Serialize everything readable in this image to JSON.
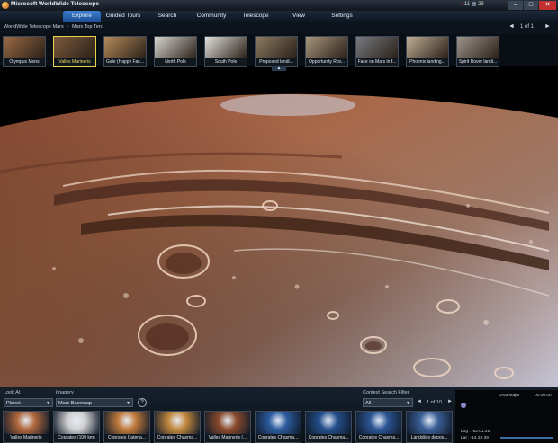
{
  "window": {
    "title": "Microsoft WorldWide Telescope",
    "tray_counts": [
      "11",
      "23"
    ],
    "controls": {
      "minimize": "–",
      "maximize": "□",
      "close": "✕"
    }
  },
  "menu": {
    "items": [
      {
        "label": "Explore",
        "active": true
      },
      {
        "label": "Guided Tours"
      },
      {
        "label": "Search"
      },
      {
        "label": "Community"
      },
      {
        "label": "Telescope"
      },
      {
        "label": "View"
      },
      {
        "label": "Settings"
      }
    ]
  },
  "breadcrumb": {
    "items": [
      "WorldWide Telescope Mars",
      "Mars Top Ten"
    ],
    "separator": "›",
    "page": "1 of 1",
    "prev": "◄",
    "next": "►"
  },
  "top_thumbnails": [
    {
      "label": "Olympus Mons",
      "icon": "mars-terrain-icon",
      "color": "#9a6a44"
    },
    {
      "label": "Valles Marineris",
      "icon": "mars-terrain-icon",
      "color": "#7d5a3c",
      "selected": true
    },
    {
      "label": "Gale (Happy Fac...",
      "icon": "mars-crater-icon",
      "color": "#b48a5a"
    },
    {
      "label": "North Pole",
      "icon": "mars-pole-icon",
      "color": "#d8d6d2"
    },
    {
      "label": "South Pole",
      "icon": "mars-pole-icon",
      "color": "#e2e0dc"
    },
    {
      "label": "Proposed landi...",
      "icon": "mars-terrain-icon",
      "color": "#8c7b62"
    },
    {
      "label": "Opportunity Rov...",
      "icon": "mars-rover-icon",
      "color": "#a8957c"
    },
    {
      "label": "Face on Mars in f...",
      "icon": "mars-face-icon",
      "color": "#777a80"
    },
    {
      "label": "Phoenix landing...",
      "icon": "mars-landing-icon",
      "color": "#bfae95"
    },
    {
      "label": "Spirit Rover landi...",
      "icon": "mars-rover-icon",
      "color": "#9c958b"
    }
  ],
  "bottom": {
    "look_at": {
      "label": "Look At",
      "value": "Planet"
    },
    "imagery": {
      "label": "Imagery",
      "value": "Mars Basemap"
    },
    "context_filter": {
      "label": "Context Search Filter",
      "value": "All"
    },
    "page": "1 of 10",
    "thumbnails": [
      {
        "label": "Valles Marineris",
        "color": "#b0673c"
      },
      {
        "label": "Coprates (100 km)",
        "color": "#cfcfcf"
      },
      {
        "label": "Coprates Catena...",
        "color": "#c07a3a"
      },
      {
        "label": "Coprates Chasma...",
        "color": "#c2883e"
      },
      {
        "label": "Valles Marineris (...",
        "color": "#8a4a2a"
      },
      {
        "label": "Coprates Chasma...",
        "color": "#2c5b9e"
      },
      {
        "label": "Coprates Chasma...",
        "color": "#244f8c"
      },
      {
        "label": "Coprates Chasma...",
        "color": "#2a5594"
      },
      {
        "label": "Landslide depos...",
        "color": "#3a5f96"
      }
    ]
  },
  "info_panel": {
    "name": "Ursa Major",
    "time": "00:00:00",
    "lng": "Lng : -62.01.25",
    "lat": "Lat : -14.32.39"
  },
  "colors": {
    "accent": "#2e6fc4",
    "selected": "#e7d34c",
    "mars": "#a0583a"
  }
}
